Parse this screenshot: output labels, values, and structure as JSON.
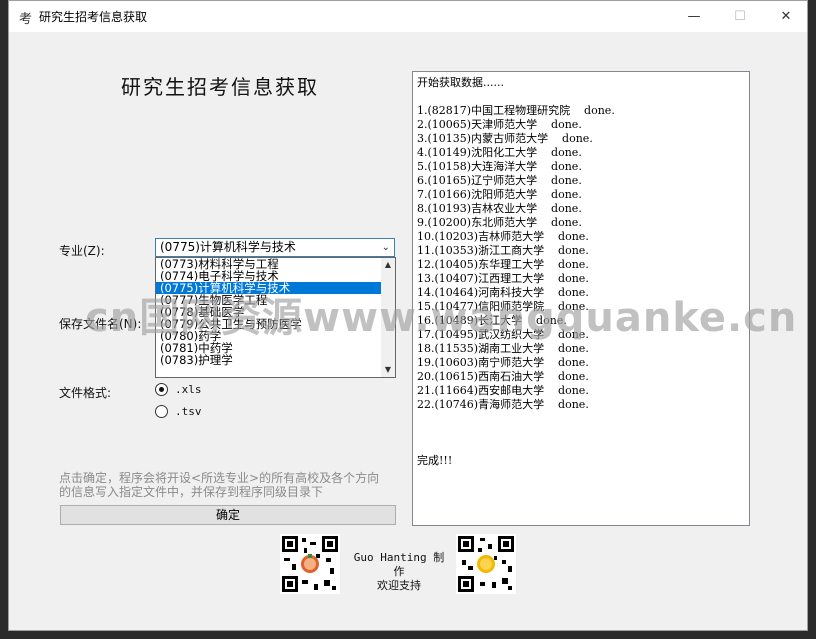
{
  "window": {
    "title": "研究生招考信息获取",
    "app_icon": "考",
    "minimize": "—",
    "maximize": "☐",
    "close": "✕"
  },
  "form": {
    "heading": "研究生招考信息获取",
    "major_label": "专业(Z):",
    "major_selected": "(0775)计算机科学与技术",
    "major_options": [
      "(0773)材料科学与工程",
      "(0774)电子科学与技术",
      "(0775)计算机科学与技术",
      "(0777)生物医学工程",
      "(0778)基础医学",
      "(0779)公共卫生与预防医学",
      "(0780)药学",
      "(0781)中药学",
      "(0783)护理学"
    ],
    "save_label": "保存文件名(N):",
    "format_label": "文件格式:",
    "format_options": [
      ".xls",
      ".tsv"
    ],
    "format_selected": ".xls",
    "hint": "点击确定，程序会将开设<所选专业>的所有高校及各个方向的信息写入指定文件中，并保存到程序同级目录下",
    "confirm": "确定"
  },
  "log": {
    "lines": [
      "开始获取数据......",
      "",
      "1.(82817)中国工程物理研究院    done.",
      "2.(10065)天津师范大学    done.",
      "3.(10135)内蒙古师范大学    done.",
      "4.(10149)沈阳化工大学    done.",
      "5.(10158)大连海洋大学    done.",
      "6.(10165)辽宁师范大学    done.",
      "7.(10166)沈阳师范大学    done.",
      "8.(10193)吉林农业大学    done.",
      "9.(10200)东北师范大学    done.",
      "10.(10203)吉林师范大学    done.",
      "11.(10353)浙江工商大学    done.",
      "12.(10405)东华理工大学    done.",
      "13.(10407)江西理工大学    done.",
      "14.(10464)河南科技大学    done.",
      "15.(10477)信阳师范学院    done.",
      "16.(10489)长江大学    done.",
      "17.(10495)武汉纺织大学    done.",
      "18.(11535)湖南工业大学    done.",
      "19.(10603)南宁师范大学    done.",
      "20.(10615)西南石油大学    done.",
      "21.(11664)西安邮电大学    done.",
      "22.(10746)青海师范大学    done.",
      "",
      "",
      "",
      "完成!!!"
    ]
  },
  "footer": {
    "author": "Guo Hanting 制作",
    "support": "欢迎支持"
  },
  "watermark": "cn国网资源www.wangquanke.cn",
  "colors": {
    "accent": "#0078d7",
    "window_bg": "#f0f0f0",
    "hint_text": "#8a8a8a"
  }
}
